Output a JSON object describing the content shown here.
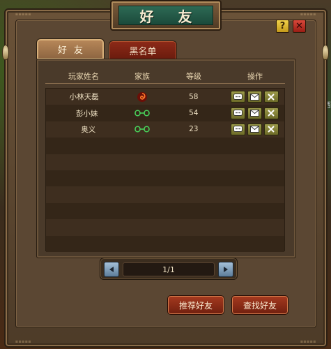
{
  "window": {
    "title": "好 友",
    "help_label": "?",
    "close_label": "✕"
  },
  "tabs": [
    {
      "label": "好友",
      "active": true
    },
    {
      "label": "黑名单",
      "active": false
    }
  ],
  "table": {
    "headers": {
      "name": "玩家姓名",
      "family": "家族",
      "level": "等级",
      "ops": "操作"
    },
    "rows": [
      {
        "name": "小林天磊",
        "family_icon": "red-swirl-icon",
        "level": "58"
      },
      {
        "name": "彭小妹",
        "family_icon": "green-crest-icon",
        "level": "54"
      },
      {
        "name": "奥义",
        "family_icon": "green-crest-icon",
        "level": "23"
      }
    ],
    "empty_rows": 7
  },
  "pager": {
    "text": "1/1"
  },
  "buttons": {
    "recommend": "推荐好友",
    "search": "查找好友"
  },
  "scene": {
    "side_text": "三西"
  },
  "colors": {
    "accent_green": "#2d6a55",
    "button_red": "#a53a1f"
  }
}
